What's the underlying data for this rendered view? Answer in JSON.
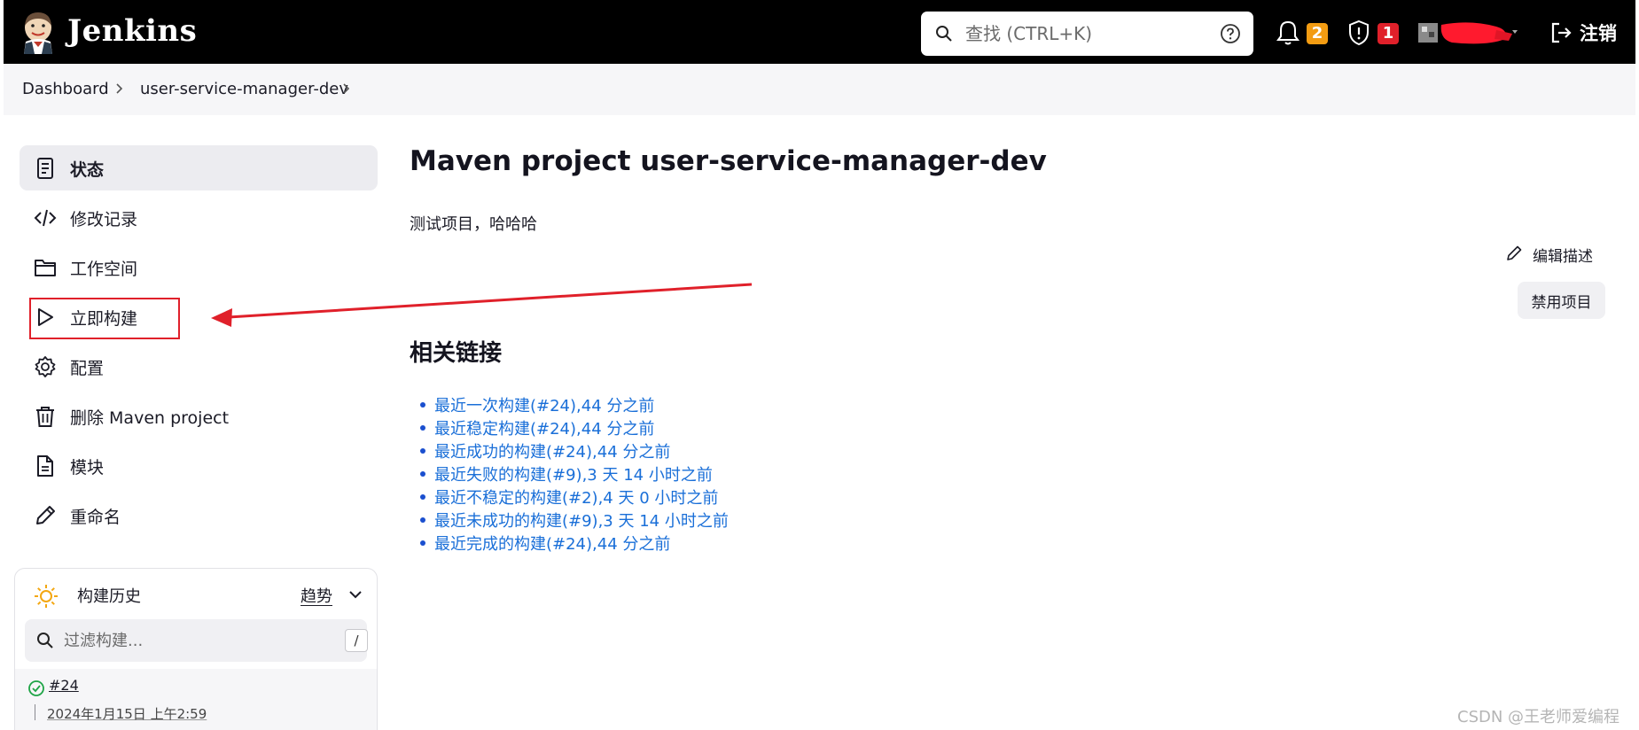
{
  "header": {
    "brand": "Jenkins",
    "search": {
      "placeholder": "查找 (CTRL+K)"
    },
    "notifications": {
      "icon": "bell-icon",
      "count": "2",
      "color": "#f39c12"
    },
    "security": {
      "icon": "shield-alert-icon",
      "count": "1",
      "color": "#e0202a"
    },
    "logout_label": "注销"
  },
  "breadcrumb": {
    "items": [
      "Dashboard",
      "user-service-manager-dev"
    ]
  },
  "sidebar": {
    "items": [
      {
        "label": "状态",
        "icon": "notepad-icon",
        "active": true
      },
      {
        "label": "修改记录",
        "icon": "code-icon"
      },
      {
        "label": "工作空间",
        "icon": "folder-icon"
      },
      {
        "label": "立即构建",
        "icon": "play-icon"
      },
      {
        "label": "配置",
        "icon": "gear-icon"
      },
      {
        "label": "删除 Maven project",
        "icon": "trash-icon"
      },
      {
        "label": "模块",
        "icon": "document-icon"
      },
      {
        "label": "重命名",
        "icon": "pencil-icon"
      }
    ]
  },
  "build_history": {
    "title": "构建历史",
    "trend_label": "趋势",
    "filter_placeholder": "过滤构建...",
    "filter_shortcut": "/",
    "builds": [
      {
        "number": "#24",
        "date": "2024年1月15日 上午2:59",
        "status": "success"
      }
    ]
  },
  "main": {
    "title": "Maven project user-service-manager-dev",
    "description": "测试项目，哈哈哈",
    "edit_description_label": "编辑描述",
    "disable_label": "禁用项目",
    "related_title": "相关链接",
    "links": [
      "最近一次构建(#24),44 分之前",
      "最近稳定构建(#24),44 分之前",
      "最近成功的构建(#24),44 分之前",
      "最近失败的构建(#9),3 天 14 小时之前",
      "最近不稳定的构建(#2),4 天 0 小时之前",
      "最近未成功的构建(#9),3 天 14 小时之前",
      "最近完成的构建(#24),44 分之前"
    ]
  },
  "annotation": {
    "color": "#e0202a"
  },
  "watermark": "CSDN @王老师爱编程"
}
